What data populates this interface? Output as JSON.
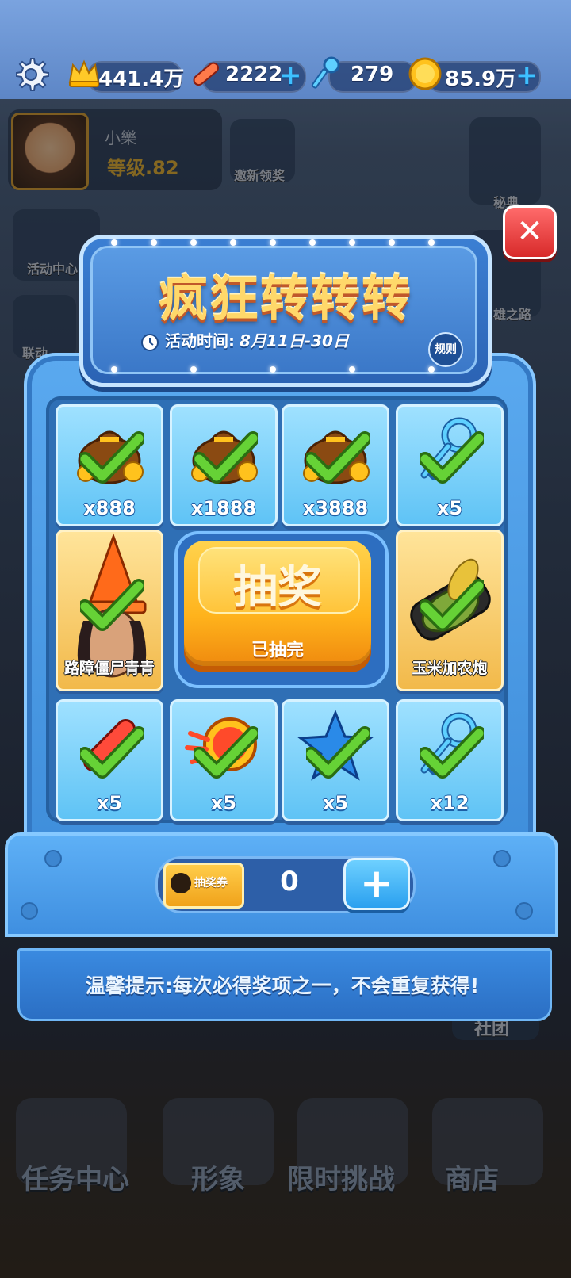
{
  "topbar": {
    "settings_icon": "gear-icon",
    "currencies": [
      {
        "icon": "crown-icon",
        "value": "441.4万",
        "has_plus": false
      },
      {
        "icon": "hoverboard-icon",
        "value": "2222",
        "has_plus": true
      },
      {
        "icon": "key-icon",
        "value": "279",
        "has_plus": false
      },
      {
        "icon": "coin-icon",
        "value": "85.9万",
        "has_plus": true
      }
    ]
  },
  "background": {
    "player_name": "小樂",
    "player_level": "等级.82",
    "invite_label": "邀新领奖",
    "activity_center": "活动中心",
    "linked": "联动",
    "secret_book": "秘典",
    "hero_road": "雄之路",
    "club": "社团"
  },
  "modal": {
    "title": "疯狂转转转",
    "time_label": "活动时间:",
    "time_value": "8月11日-30日",
    "rules": "规则",
    "prizes": [
      {
        "name": "coin-bag",
        "qty": "x888",
        "claimed": true
      },
      {
        "name": "coin-bag",
        "qty": "x1888",
        "claimed": true
      },
      {
        "name": "coin-bag",
        "qty": "x3888",
        "claimed": true
      },
      {
        "name": "key",
        "qty": "x5",
        "claimed": true
      },
      {
        "name": "路障僵尸青青",
        "qty": "",
        "claimed": true
      },
      {
        "name": "玉米加农炮",
        "qty": "",
        "claimed": true
      },
      {
        "name": "hoverboard",
        "qty": "x5",
        "claimed": true
      },
      {
        "name": "headstart",
        "qty": "x5",
        "claimed": true
      },
      {
        "name": "score-booster",
        "qty": "x5",
        "claimed": true
      },
      {
        "name": "key",
        "qty": "x12",
        "claimed": true
      }
    ],
    "draw_button": "抽奖",
    "draw_status": "已抽完",
    "ticket_label": "抽奖券",
    "ticket_count": "0",
    "ticket_plus": "+",
    "tip": "温馨提示:每次必得奖项之一，不会重复获得!"
  },
  "bottom_nav": [
    {
      "label": "任务中心",
      "icon": "trophy-icon"
    },
    {
      "label": "形象",
      "icon": "character-icon"
    },
    {
      "label": "限时挑战",
      "icon": "calendar-icon"
    },
    {
      "label": "商店",
      "icon": "shop-bag-icon"
    }
  ],
  "colors": {
    "accent": "#3f8edb",
    "gold": "#ffb31c",
    "close": "#d82a2a",
    "check": "#4fc02a"
  }
}
